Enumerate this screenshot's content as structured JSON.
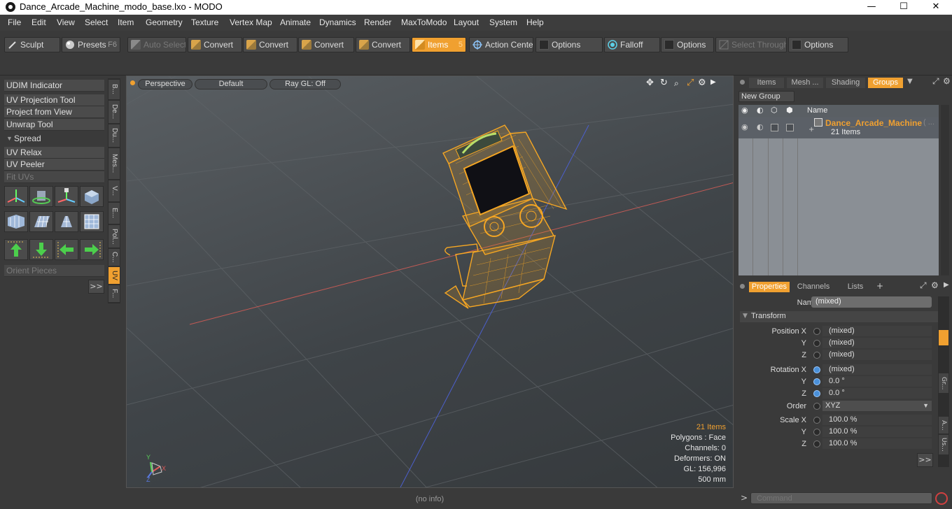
{
  "window": {
    "title": "Dance_Arcade_Machine_modo_base.lxo - MODO",
    "minimize": "—",
    "maximize": "☐",
    "close": "✕"
  },
  "menu": [
    "File",
    "Edit",
    "View",
    "Select",
    "Item",
    "Geometry",
    "Texture",
    "Vertex Map",
    "Animate",
    "Dynamics",
    "Render",
    "MaxToModo",
    "Layout",
    "System",
    "Help"
  ],
  "toolbar": {
    "sculpt": "Sculpt",
    "presets": "Presets",
    "presets_key": "F6",
    "auto_select": "Auto Select",
    "convert1": "Convert",
    "convert2": "Convert",
    "convert3": "Convert",
    "convert4": "Convert",
    "items": "Items",
    "items_key": "5",
    "action_center": "Action Center",
    "options1": "Options",
    "falloff": "Falloff",
    "options2": "Options",
    "select_through": "Select Through",
    "options3": "Options"
  },
  "left_panel": {
    "udim": "UDIM Indicator",
    "uv_projection": "UV Projection Tool",
    "project_from_view": "Project from View",
    "unwrap": "Unwrap Tool",
    "spread": "Spread",
    "uv_relax": "UV Relax",
    "uv_peeler": "UV Peeler",
    "fit_uvs": "Fit UVs",
    "orient_pieces": "Orient Pieces",
    "more": ">>",
    "vtabs": [
      "B...",
      "De...",
      "Du...",
      "Mes...",
      "V...",
      "E...",
      "Pol...",
      "C...",
      "UV",
      "F..."
    ]
  },
  "viewport": {
    "perspective": "Perspective",
    "default": "Default",
    "raygl": "Ray GL: Off",
    "info": {
      "items": "21 Items",
      "polygons": "Polygons : Face",
      "channels": "Channels: 0",
      "deformers": "Deformers: ON",
      "gl": "GL: 156,996",
      "scale": "500 mm"
    },
    "axis_x": "X",
    "axis_y": "Y",
    "axis_z": "Z"
  },
  "status": "(no info)",
  "groups_panel": {
    "tabs": [
      "Items",
      "Mesh ...",
      "Shading",
      "Groups"
    ],
    "new_group": "New Group",
    "col_name": "Name",
    "row_name": "Dance_Arcade_Machine",
    "row_ellipsis": "( ...",
    "row_count": "21 Items"
  },
  "properties": {
    "tabs": [
      "Properties",
      "Channels",
      "Lists"
    ],
    "add_tab": "+",
    "name_label": "Name",
    "name_value": "(mixed)",
    "transform": "Transform",
    "position_x_label": "Position X",
    "position_x": "(mixed)",
    "position_y_label": "Y",
    "position_y": "(mixed)",
    "position_z_label": "Z",
    "position_z": "(mixed)",
    "rotation_x_label": "Rotation X",
    "rotation_x": "(mixed)",
    "rotation_y_label": "Y",
    "rotation_y": "0.0 °",
    "rotation_z_label": "Z",
    "rotation_z": "0.0 °",
    "order_label": "Order",
    "order": "XYZ",
    "scale_x_label": "Scale X",
    "scale_x": "100.0 %",
    "scale_y_label": "Y",
    "scale_y": "100.0 %",
    "scale_z_label": "Z",
    "scale_z": "100.0 %",
    "more": ">>",
    "side_tabs": [
      "Gr...",
      "A...",
      "Us..."
    ]
  },
  "command": {
    "prompt": ">",
    "placeholder": "Command"
  },
  "colors": {
    "accent": "#f0a030",
    "wireframe": "#f5a623"
  }
}
